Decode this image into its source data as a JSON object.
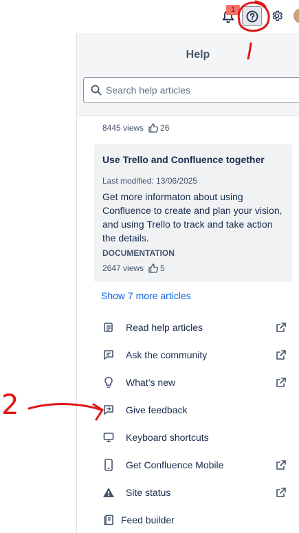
{
  "topbar": {
    "notification_count": "1",
    "icons": [
      "bell-icon",
      "help-icon",
      "gear-icon",
      "avatar"
    ]
  },
  "help": {
    "title": "Help",
    "search_placeholder": "Search help articles",
    "prev_article": {
      "views": "8445 views",
      "likes": "26"
    },
    "article": {
      "title": "Use Trello and Confluence together",
      "last_modified": "Last modified: 13/06/2025",
      "description": "Get more informaton about using Confluence to create and plan your vision, and using Trello to track and take action the details.",
      "type": "DOCUMENTATION",
      "views": "2647 views",
      "likes": "5"
    },
    "show_more": "Show 7 more articles",
    "links": [
      {
        "label": "Read help articles",
        "icon": "book-icon",
        "external": true
      },
      {
        "label": "Ask the community",
        "icon": "comment-icon",
        "external": true
      },
      {
        "label": "What’s new",
        "icon": "lightbulb-icon",
        "external": true
      },
      {
        "label": "Give feedback",
        "icon": "feedback-icon",
        "external": false
      },
      {
        "label": "Keyboard shortcuts",
        "icon": "monitor-icon",
        "external": false
      },
      {
        "label": "Get Confluence Mobile",
        "icon": "mobile-icon",
        "external": true
      },
      {
        "label": "Site status",
        "icon": "warning-icon",
        "external": true
      },
      {
        "label": "Feed builder",
        "icon": "feed-icon",
        "external": false
      }
    ]
  },
  "annotations": {
    "marker_1": "1",
    "marker_2": "2",
    "color": "#e01616"
  }
}
